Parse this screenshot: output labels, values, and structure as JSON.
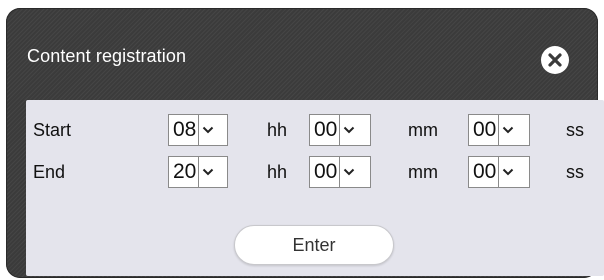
{
  "dialog": {
    "title": "Content registration",
    "close_icon": "close-circle-icon"
  },
  "start": {
    "label": "Start",
    "hour": "08",
    "minute": "00",
    "second": "00"
  },
  "end": {
    "label": "End",
    "hour": "20",
    "minute": "00",
    "second": "00"
  },
  "units": {
    "hh": "hh",
    "mm": "mm",
    "ss": "ss"
  },
  "enter_label": "Enter",
  "colors": {
    "dialog_bg": "#3b3b3b",
    "panel_bg": "#e4e4ec",
    "text": "#111111"
  }
}
